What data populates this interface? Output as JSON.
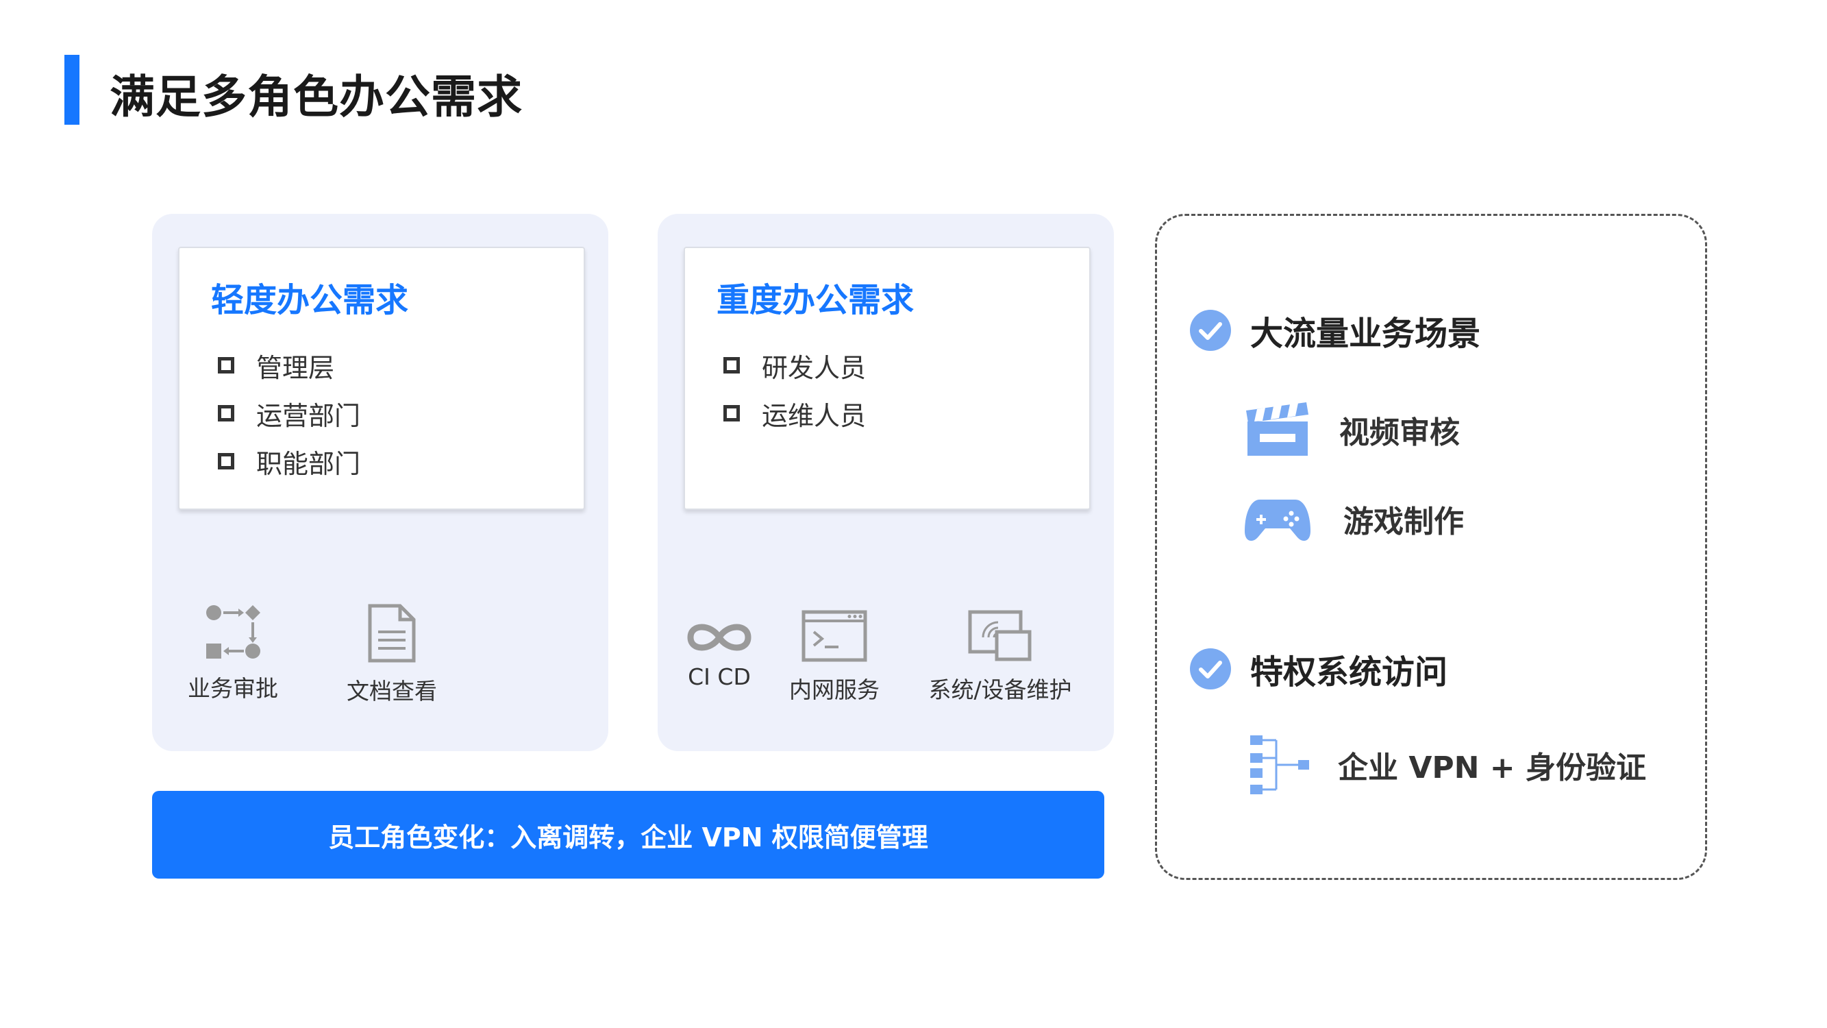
{
  "title": "满足多角色办公需求",
  "light_panel": {
    "title": "轻度办公需求",
    "items": [
      "管理层",
      "运营部门",
      "职能部门"
    ],
    "features": [
      {
        "label": "业务审批",
        "icon": "workflow-icon"
      },
      {
        "label": "文档查看",
        "icon": "document-icon"
      }
    ]
  },
  "heavy_panel": {
    "title": "重度办公需求",
    "items": [
      "研发人员",
      "运维人员"
    ],
    "features": [
      {
        "label": "CI CD",
        "icon": "infinity-icon"
      },
      {
        "label": "内网服务",
        "icon": "terminal-icon"
      },
      {
        "label": "系统/设备维护",
        "icon": "remote-device-icon"
      }
    ]
  },
  "banner": "员工角色变化：入离调转，企业 VPN 权限简便管理",
  "scenarios": {
    "section1": {
      "title": "大流量业务场景",
      "items": [
        {
          "label": "视频审核",
          "icon": "clapperboard-icon"
        },
        {
          "label": "游戏制作",
          "icon": "gamepad-icon"
        }
      ]
    },
    "section2": {
      "title": "特权系统访问",
      "items": [
        {
          "label": "企业 VPN + 身份验证",
          "icon": "network-tree-icon"
        }
      ]
    }
  },
  "colors": {
    "accent": "#1677ff",
    "panel_bg": "#eef1fb",
    "icon_gray": "#9a9a9a",
    "icon_blue": "#7aaaf2"
  }
}
